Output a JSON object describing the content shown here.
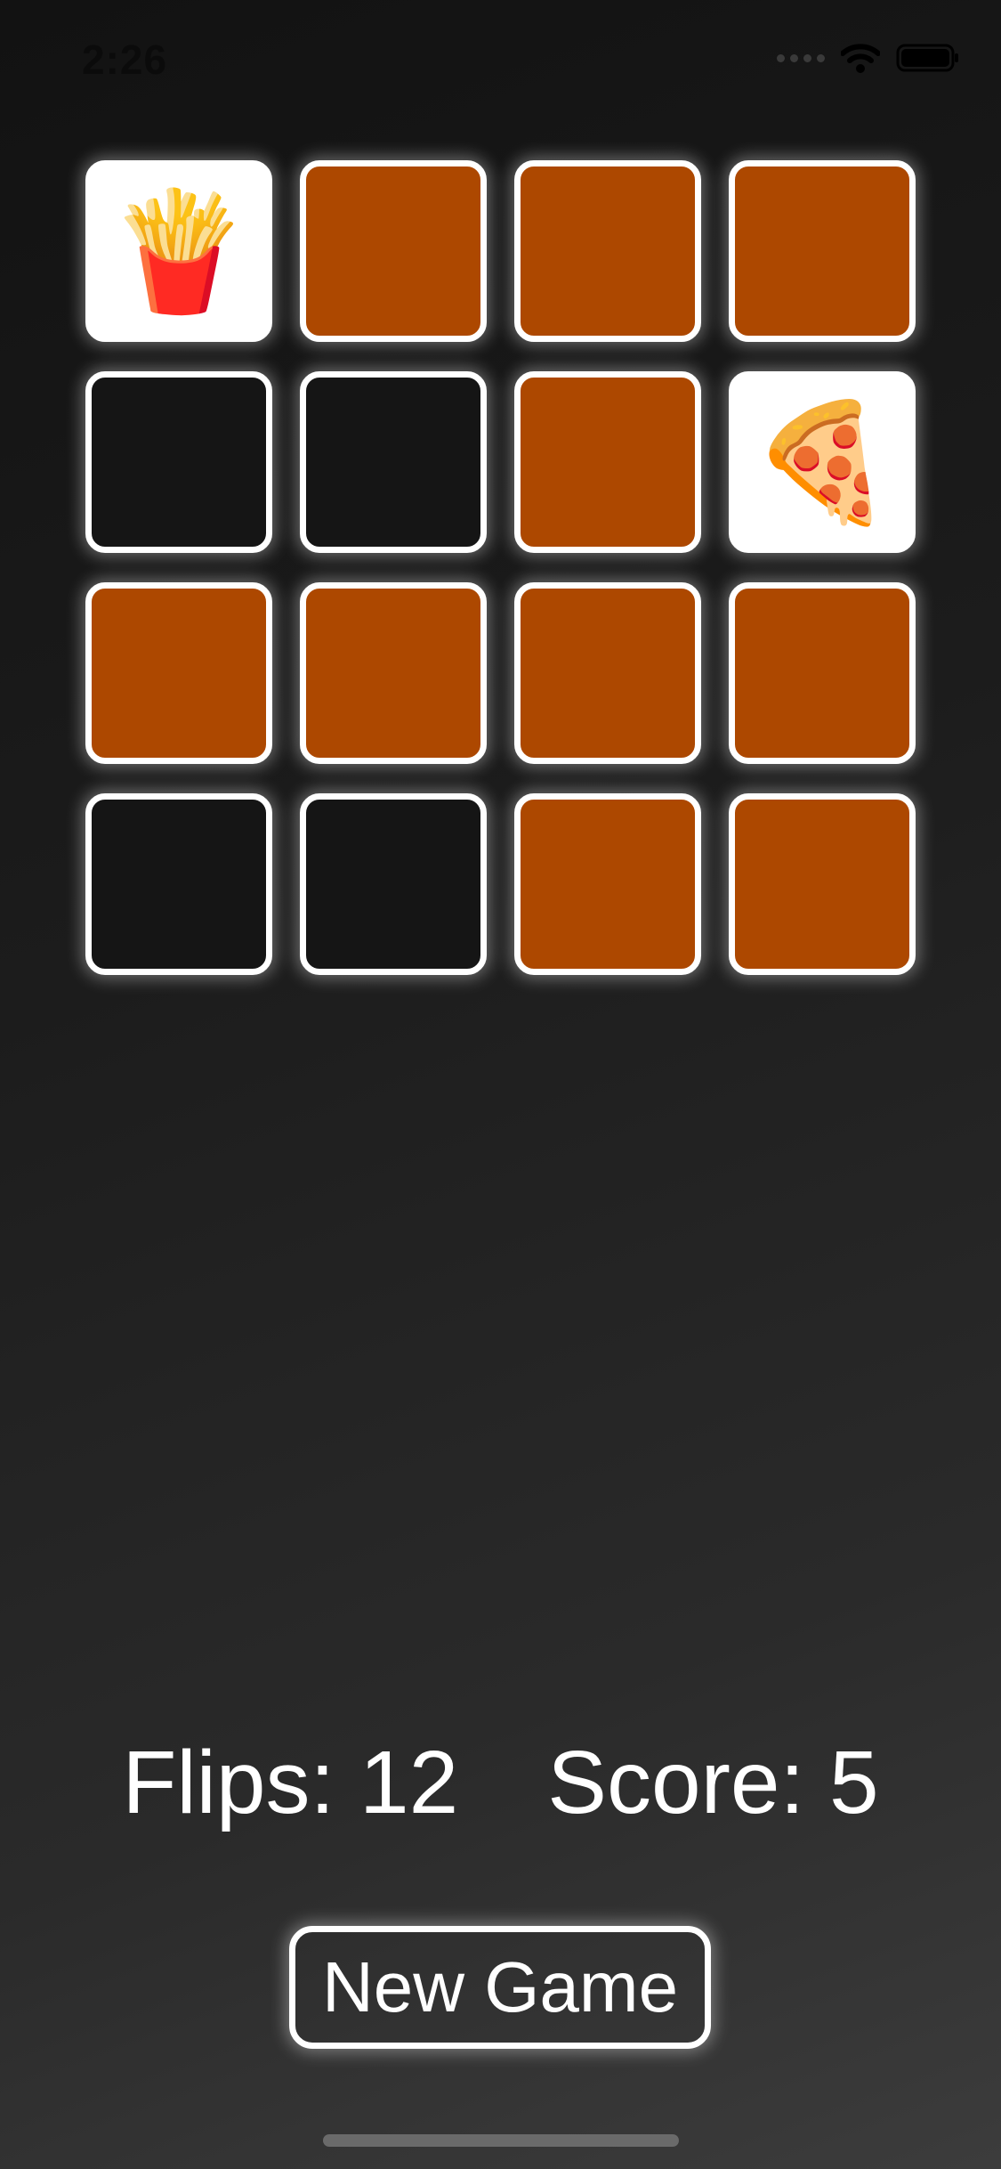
{
  "status_bar": {
    "time": "2:26",
    "icons": [
      "cellular-signal-icon",
      "wifi-icon",
      "battery-icon"
    ]
  },
  "colors": {
    "card_back": "#ad4800",
    "matched_card": "#151515",
    "face_up_card": "#ffffff",
    "border": "#ffffff"
  },
  "cards": [
    {
      "state": "face-up",
      "emoji": "🍟"
    },
    {
      "state": "face-down",
      "emoji": ""
    },
    {
      "state": "face-down",
      "emoji": ""
    },
    {
      "state": "face-down",
      "emoji": ""
    },
    {
      "state": "matched",
      "emoji": ""
    },
    {
      "state": "matched",
      "emoji": ""
    },
    {
      "state": "face-down",
      "emoji": ""
    },
    {
      "state": "face-up",
      "emoji": "🍕"
    },
    {
      "state": "face-down",
      "emoji": ""
    },
    {
      "state": "face-down",
      "emoji": ""
    },
    {
      "state": "face-down",
      "emoji": ""
    },
    {
      "state": "face-down",
      "emoji": ""
    },
    {
      "state": "matched",
      "emoji": ""
    },
    {
      "state": "matched",
      "emoji": ""
    },
    {
      "state": "face-down",
      "emoji": ""
    },
    {
      "state": "face-down",
      "emoji": ""
    }
  ],
  "scoreboard": {
    "flips_label": "Flips: 12",
    "score_label": "Score: 5"
  },
  "new_game_button": {
    "label": "New Game"
  }
}
